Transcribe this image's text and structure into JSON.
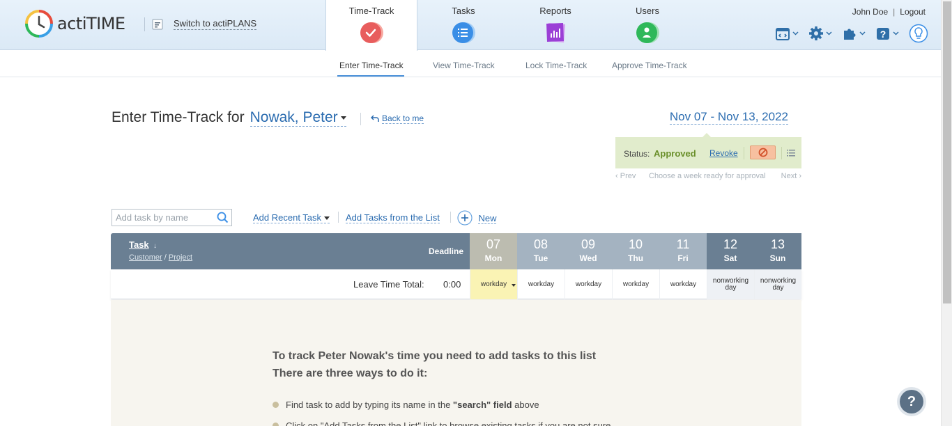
{
  "header": {
    "logo_text": "actiTIME",
    "switch_label": "Switch to actiPLANS",
    "user_name": "John Doe",
    "logout_label": "Logout",
    "tabs": [
      {
        "label": "Time-Track",
        "icon": "time-track-icon",
        "color": "#e85d5d",
        "active": true
      },
      {
        "label": "Tasks",
        "icon": "tasks-icon",
        "color": "#3a8ee6"
      },
      {
        "label": "Reports",
        "icon": "reports-icon",
        "color": "#9b3fd6"
      },
      {
        "label": "Users",
        "icon": "users-icon",
        "color": "#2fb85a"
      }
    ],
    "tools": [
      "apps-icon",
      "gear-icon",
      "puzzle-icon",
      "help-icon",
      "lightbulb-icon"
    ]
  },
  "subnav": {
    "items": [
      "Enter Time-Track",
      "View Time-Track",
      "Lock Time-Track",
      "Approve Time-Track"
    ],
    "active": "Enter Time-Track"
  },
  "title": {
    "prefix": "Enter Time-Track for",
    "user": "Nowak, Peter",
    "back_label": "Back to me",
    "date_range": "Nov 07 - Nov 13, 2022"
  },
  "status": {
    "label": "Status:",
    "value": "Approved",
    "revoke_label": "Revoke",
    "prev_label": "Prev",
    "hint": "Choose a week ready for approval",
    "next_label": "Next",
    "color": "#6a8f2a"
  },
  "add_task": {
    "search_placeholder": "Add task by name",
    "recent_label": "Add Recent Task",
    "from_list_label": "Add Tasks from the List",
    "new_label": "New"
  },
  "grid": {
    "task_header": "Task",
    "customer_label": "Customer",
    "project_label": "Project",
    "slash": "/",
    "deadline_label": "Deadline",
    "days": [
      {
        "num": "07",
        "wd": "Mon",
        "type": "today",
        "status": "workday"
      },
      {
        "num": "08",
        "wd": "Tue",
        "type": "work",
        "status": "workday"
      },
      {
        "num": "09",
        "wd": "Wed",
        "type": "work",
        "status": "workday"
      },
      {
        "num": "10",
        "wd": "Thu",
        "type": "work",
        "status": "workday"
      },
      {
        "num": "11",
        "wd": "Fri",
        "type": "work",
        "status": "workday"
      },
      {
        "num": "12",
        "wd": "Sat",
        "type": "weekend",
        "status": "nonworking day"
      },
      {
        "num": "13",
        "wd": "Sun",
        "type": "weekend",
        "status": "nonworking day"
      }
    ],
    "leave_label": "Leave Time Total:",
    "leave_total": "0:00"
  },
  "empty_state": {
    "line1": "To track Peter Nowak's time you need to add tasks to this list",
    "line2": "There are three ways to do it:",
    "bullet1_pre": "Find task to add by typing its name in the ",
    "bullet1_bold": "\"search\" field",
    "bullet1_post": " above",
    "bullet2": "Click on \"Add Tasks from the List\" link to browse existing tasks if you are not sure"
  },
  "help_label": "?"
}
